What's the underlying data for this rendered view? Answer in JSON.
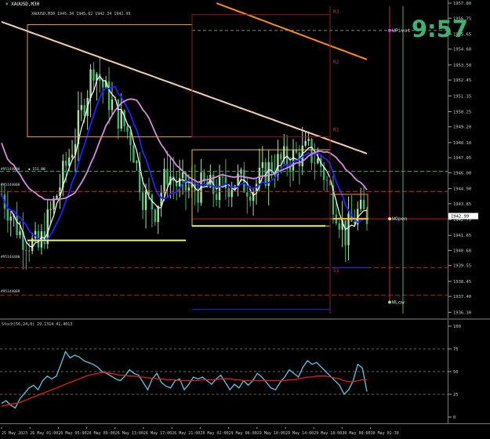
{
  "window": {
    "title": "XAUUSD,M30",
    "subtitle": "XAUUSD,M30 1945.34 1945.62 1942.34 1942.99",
    "clock": "9:57"
  },
  "chart_data": [
    {
      "type": "candlestick",
      "symbol": "XAUUSD",
      "timeframe": "M30",
      "ylim": [
        1936.1,
        1957.8
      ],
      "y_ticks": [
        "1957.80",
        "1956.75",
        "1955.65",
        "1954.60",
        "1953.50",
        "1952.45",
        "1951.35",
        "1950.25",
        "1949.20",
        "1948.10",
        "1947.05",
        "1946.00",
        "1944.90",
        "1943.85",
        "1942.75",
        "1941.65",
        "1940.60",
        "1939.55",
        "1938.45",
        "1937.40",
        "1936.30"
      ],
      "current_price": "1942.99",
      "level_labels": [
        {
          "text": "WPivot",
          "price": 1955.9
        },
        {
          "text": "WOpen",
          "price": 1942.8
        },
        {
          "text": "WLow",
          "price": 1937.0
        },
        {
          "text": "R3",
          "price": 1957.2
        },
        {
          "text": "R2",
          "price": 1953.7
        },
        {
          "text": "R1",
          "price": 1949.0
        },
        {
          "text": "S1",
          "price": 1939.2
        }
      ],
      "left_labels": [
        {
          "text": "#95144090 ",
          "price": 1946.3
        },
        {
          "text": "#95144088 ",
          "price": 1945.2
        },
        {
          "text": "#95144480 ",
          "price": 1940.2
        },
        {
          "text": "#95144089 ",
          "price": 1937.8
        }
      ],
      "order_tag": "151.00",
      "x_ticks": [
        "25 May 2023",
        "26 May 01:00",
        "26 May 05:00",
        "26 May 09:00",
        "26 May 13:00",
        "26 May 17:00",
        "26 May 21:00",
        "29 May 02:00",
        "29 May 06:00",
        "29 May 10:00",
        "29 May 14:00",
        "29 May 18:00",
        "30 May 00:00",
        "30 May 02:30"
      ],
      "colors": {
        "bull": "#a8e29a",
        "bear": "#3cb371",
        "ma_fast": "#ffffff",
        "ma_blue": "#2222ff",
        "ma_violet": "#d98be0",
        "ma_cream": "#f3cfb0",
        "ma_orange": "#ff8c1a"
      }
    },
    {
      "type": "line",
      "title": "Stoch(56,24,0) 29.1314 41.4013",
      "ylim": [
        0,
        100
      ],
      "y_ticks": [
        "100",
        "75",
        "50",
        "25",
        "0"
      ],
      "series": [
        {
          "name": "main",
          "color": "#5bc8e6",
          "values": [
            15,
            18,
            13,
            10,
            20,
            26,
            32,
            35,
            30,
            40,
            45,
            42,
            45,
            58,
            72,
            65,
            68,
            66,
            62,
            60,
            58,
            55,
            50,
            48,
            45,
            42,
            40,
            45,
            52,
            48,
            46,
            38,
            30,
            42,
            48,
            38,
            34,
            32,
            40,
            42,
            30,
            36,
            44,
            42,
            44,
            40,
            36,
            42,
            46,
            38,
            30,
            36,
            32,
            40,
            35,
            40,
            48,
            44,
            38,
            32,
            30,
            38,
            44,
            52,
            48,
            44,
            55,
            62,
            58,
            60,
            55,
            50,
            45,
            40,
            35,
            25,
            30,
            40,
            58,
            54,
            28
          ]
        },
        {
          "name": "signal",
          "color": "#e02020",
          "values": [
            12,
            13,
            14,
            15,
            16,
            18,
            20,
            22,
            24,
            26,
            28,
            30,
            32,
            34,
            36,
            38,
            40,
            42,
            44,
            46,
            47,
            48,
            49,
            49,
            48,
            47,
            46,
            46,
            45,
            45,
            44,
            44,
            43,
            43,
            42,
            42,
            41,
            41,
            41,
            40,
            40,
            40,
            40,
            40,
            41,
            41,
            41,
            41,
            42,
            42,
            42,
            41,
            41,
            40,
            40,
            40,
            40,
            40,
            40,
            40,
            40,
            40,
            40,
            41,
            41,
            42,
            43,
            44,
            44,
            45,
            45,
            45,
            44,
            43,
            42,
            40,
            39,
            39,
            40,
            41,
            41
          ]
        }
      ]
    }
  ]
}
